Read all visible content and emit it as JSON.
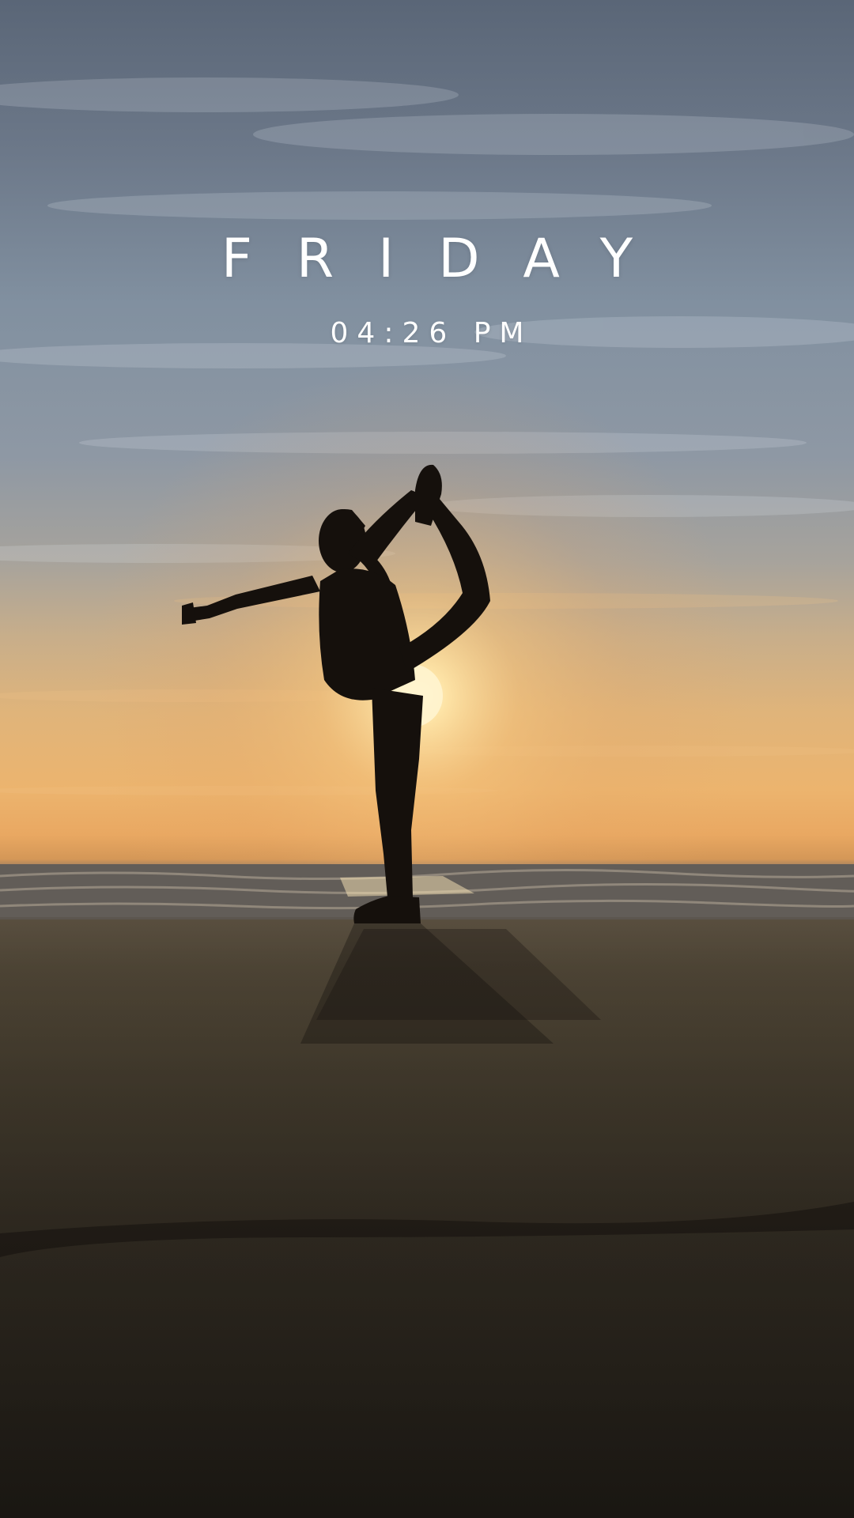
{
  "lock_screen": {
    "day": "FRIDAY",
    "time": "04:26 PM"
  },
  "wallpaper": {
    "subject": "yoga-pose-silhouette-beach-sunset",
    "colors": {
      "sky_top": "#5a6677",
      "sky_mid": "#8e98a4",
      "horizon_glow": "#ecb46e",
      "sun": "#fff4cf",
      "sea": "#6d6863",
      "sand": "#2a251e",
      "silhouette": "#15100c"
    }
  }
}
